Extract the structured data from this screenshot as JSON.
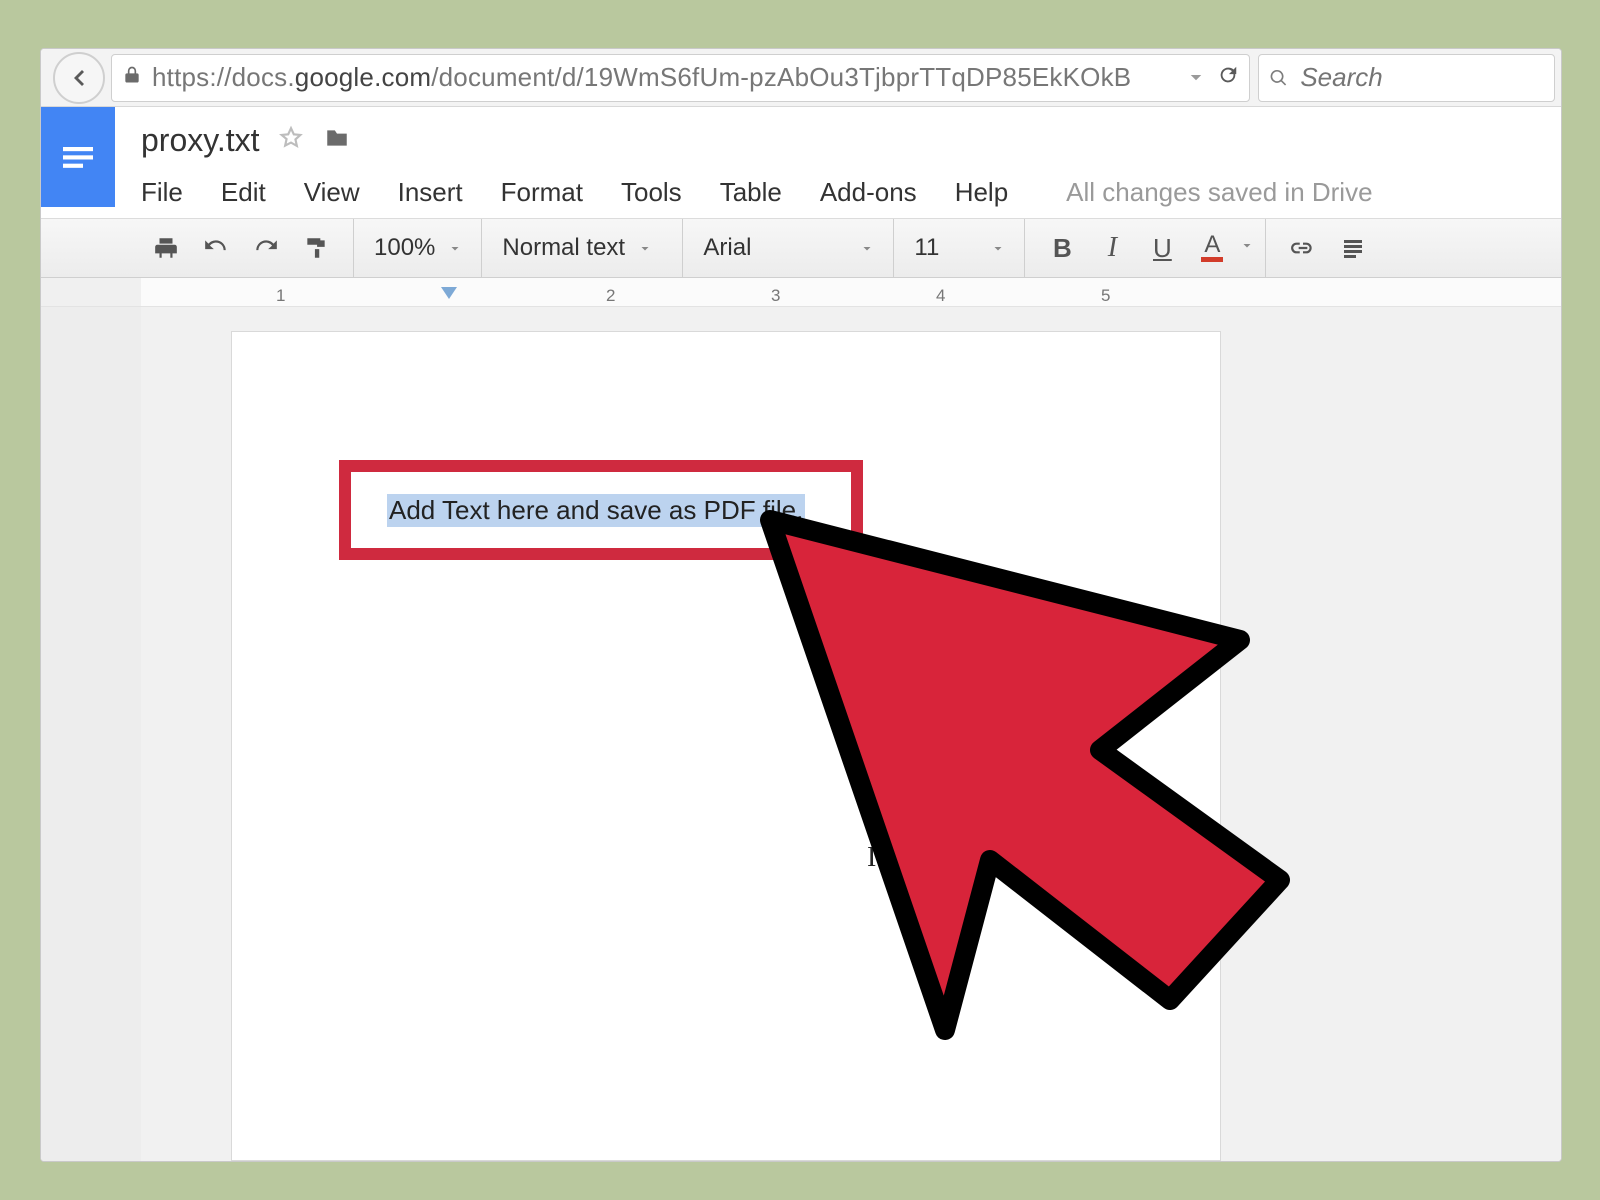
{
  "browser": {
    "url_prefix": "https://docs.",
    "url_domain": "google.com",
    "url_rest": "/document/d/19WmS6fUm-pzAbOu3TjbprTTqDP85EkKOkB",
    "search_placeholder": "Search"
  },
  "header": {
    "title": "proxy.txt",
    "save_status": "All changes saved in Drive"
  },
  "menus": [
    "File",
    "Edit",
    "View",
    "Insert",
    "Format",
    "Tools",
    "Table",
    "Add-ons",
    "Help"
  ],
  "toolbar": {
    "zoom": "100%",
    "style": "Normal text",
    "font": "Arial",
    "size": "11",
    "bold": "B",
    "italic": "I",
    "underline": "U",
    "textcolor_letter": "A"
  },
  "ruler": {
    "marks": [
      "1",
      "2",
      "3",
      "4",
      "5"
    ]
  },
  "document": {
    "selected_text": "Add Text here and save as PDF file.",
    "caret_glyph": "I"
  }
}
